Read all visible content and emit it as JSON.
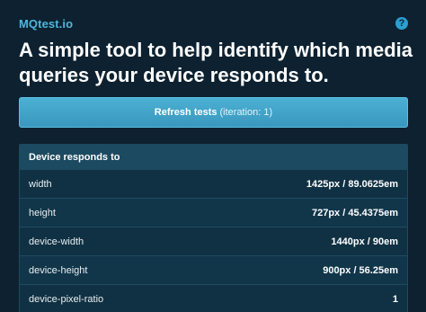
{
  "site": {
    "brand": "MQtest.io",
    "help_icon": "?",
    "headline": "A simple tool to help identify which media queries your device responds to."
  },
  "refresh": {
    "label": "Refresh tests",
    "iteration": "(iteration: 1)"
  },
  "results": {
    "header": "Device responds to",
    "rows": [
      {
        "label": "width",
        "value": "1425px / 89.0625em"
      },
      {
        "label": "height",
        "value": "727px / 45.4375em"
      },
      {
        "label": "device-width",
        "value": "1440px / 90em"
      },
      {
        "label": "device-height",
        "value": "900px / 56.25em"
      },
      {
        "label": "device-pixel-ratio",
        "value": "1"
      }
    ]
  },
  "colors": {
    "background": "#0d2130",
    "accent": "#4fb6dc",
    "button": "#3fa3c8",
    "panel": "#11364a"
  }
}
